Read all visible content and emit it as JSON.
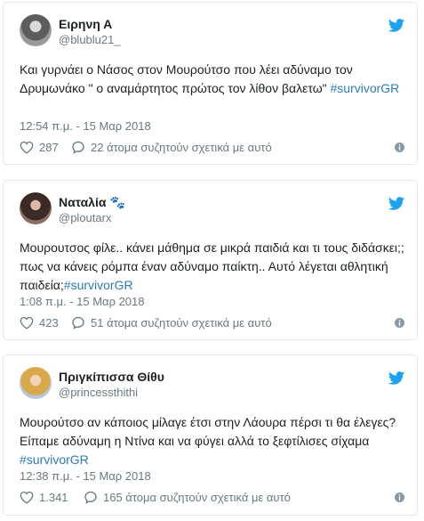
{
  "tweets": [
    {
      "name": "Ειρηνη Α",
      "emoji": "",
      "handle": "@blublu21_",
      "text": "Και γυρνάει ο Νάσος στον Μουρούτσο που λέει αδύναμο τον Δρυμωνάκο \" ο αναμάρτητος πρώτος τον λίθον βαλετω\" ",
      "hashtag": "#survivorGR",
      "date": "12:54 π.μ. - 15 Μαρ 2018",
      "likes": "287",
      "talking": "22 άτομα συζητούν σχετικά με αυτό"
    },
    {
      "name": "Ναταλία",
      "emoji": "🐾",
      "handle": "@ploutarx",
      "text": "Μουρουτσος φίλε..  κάνει μάθημα σε μικρά παιδιά και τι τους διδάσκει;; πως να κάνεις ρόμπα έναν αδύναμο παίκτη.. Αυτό λέγεται αθλητική παιδεία;",
      "hashtag": "#survivorGR",
      "date": "1:08 π.μ. - 15 Μαρ 2018",
      "likes": "423",
      "talking": "51 άτομα συζητούν σχετικά με αυτό"
    },
    {
      "name": "Πριγκίπισσα Θίθυ",
      "emoji": "",
      "handle": "@princessthithi",
      "text": "Μουρούτσο αν κάποιος μίλαγε έτσι στην Λάουρα πέρσι τι θα έλεγες? Είπαμε αδύναμη η Ντίνα και να φύγει αλλά το ξεφτίλισες σίχαμα ",
      "hashtag": "#survivorGR",
      "date": "12:38 π.μ. - 15 Μαρ 2018",
      "likes": "1.341",
      "talking": "165 άτομα συζητούν σχετικά με αυτό"
    }
  ],
  "colors": {
    "link": "#2b7bb9",
    "muted": "#697882",
    "twitter_blue": "#1da1f2",
    "border": "#e1e8ed"
  },
  "icons": {
    "brand": "twitter-bird-icon",
    "like": "heart-icon",
    "reply": "speech-bubble-icon",
    "info": "info-icon"
  }
}
